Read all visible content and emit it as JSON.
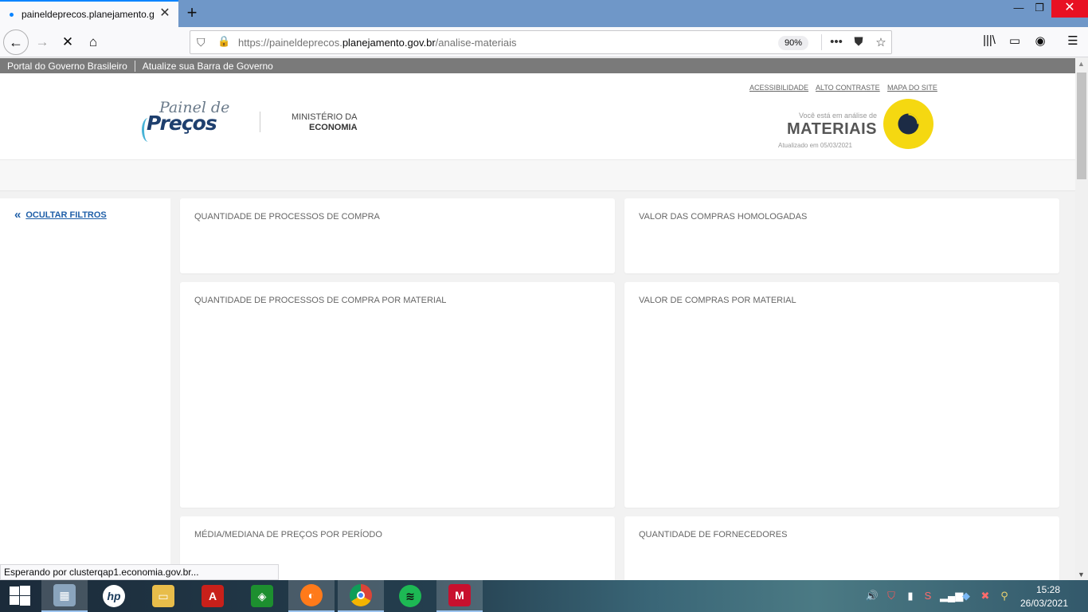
{
  "browser": {
    "tab_title": "paineldeprecos.planejamento.gov.br/analise-materiais",
    "url_prefix": "https://paineldeprecos.",
    "url_domain": "planejamento.gov.br",
    "url_path": "/analise-materiais",
    "zoom": "90%",
    "status_text": "Esperando por clusterqap1.economia.gov.br..."
  },
  "govbar": {
    "portal": "Portal do Governo Brasileiro",
    "atualize": "Atualize sua Barra de Governo"
  },
  "header": {
    "logo_top": "Painel de",
    "logo_bottom": "Preços",
    "ministerio_top": "MINISTÉRIO DA",
    "ministerio_bottom": "ECONOMIA",
    "links": [
      "ACESSIBILIDADE",
      "ALTO CONTRASTE",
      "MAPA DO SITE"
    ],
    "voce": "Você está em análise de",
    "section": "MATERIAIS",
    "updated": "Atualizado em 05/03/2021",
    "accent_color": "#f5d811"
  },
  "sidebar": {
    "hide_filters": "OCULTAR FILTROS"
  },
  "cards": [
    "QUANTIDADE DE PROCESSOS DE COMPRA",
    "VALOR DAS COMPRAS HOMOLOGADAS",
    "QUANTIDADE DE PROCESSOS DE COMPRA POR MATERIAL",
    "VALOR DE COMPRAS POR MATERIAL",
    "MÉDIA/MEDIANA DE PREÇOS POR PERÍODO",
    "QUANTIDADE DE FORNECEDORES"
  ],
  "taskbar": {
    "time": "15:28",
    "date": "26/03/2021"
  }
}
